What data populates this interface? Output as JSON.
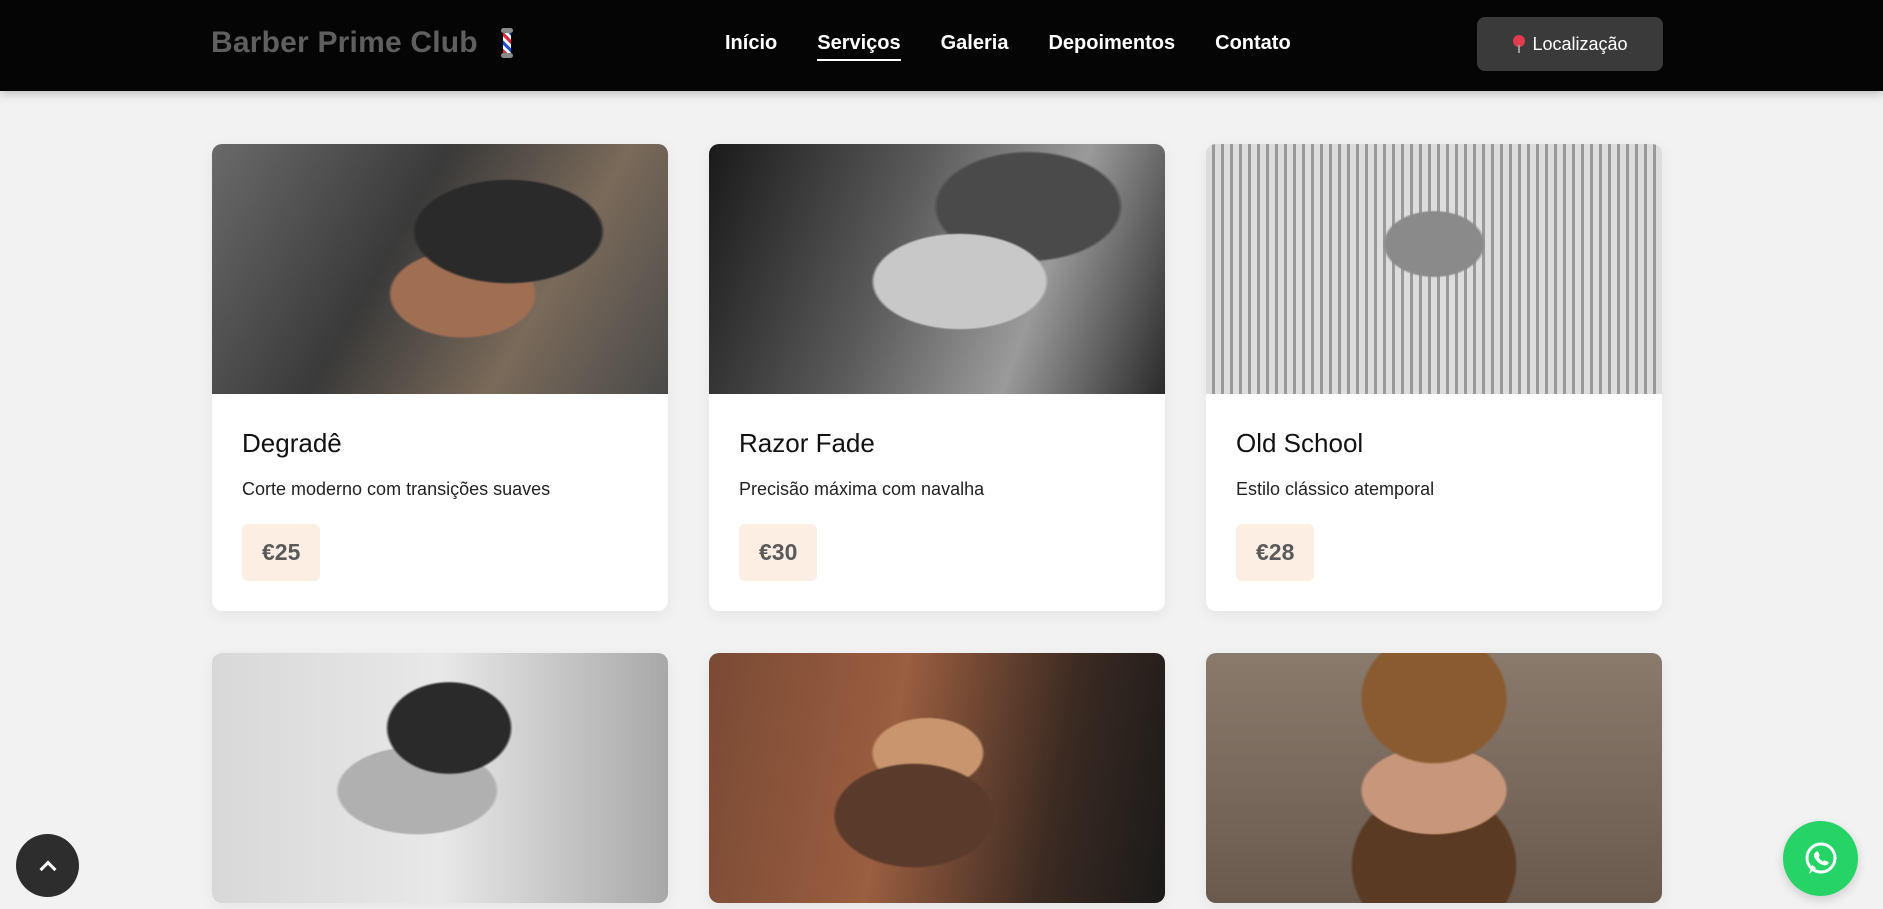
{
  "header": {
    "brand": "Barber Prime Club",
    "brand_icon": "barber-pole-icon",
    "nav": [
      {
        "label": "Início",
        "active": false
      },
      {
        "label": "Serviços",
        "active": true
      },
      {
        "label": "Galeria",
        "active": false
      },
      {
        "label": "Depoimentos",
        "active": false
      },
      {
        "label": "Contato",
        "active": false
      }
    ],
    "location_button": {
      "icon": "pin-icon",
      "label": "Localização"
    }
  },
  "services": [
    {
      "title": "Degradê",
      "description": "Corte moderno com transições suaves",
      "price": "€25"
    },
    {
      "title": "Razor Fade",
      "description": "Precisão máxima com navalha",
      "price": "€30"
    },
    {
      "title": "Old School",
      "description": "Estilo clássico atemporal",
      "price": "€28"
    },
    {
      "title": "",
      "description": "",
      "price": ""
    },
    {
      "title": "",
      "description": "",
      "price": ""
    },
    {
      "title": "",
      "description": "",
      "price": ""
    }
  ],
  "floating": {
    "scroll_top_icon": "chevron-up-icon",
    "whatsapp_icon": "whatsapp-icon"
  },
  "colors": {
    "header_bg": "#050505",
    "page_bg": "#f2f2f2",
    "price_badge_bg": "#fdeee4",
    "whatsapp": "#25d366"
  }
}
